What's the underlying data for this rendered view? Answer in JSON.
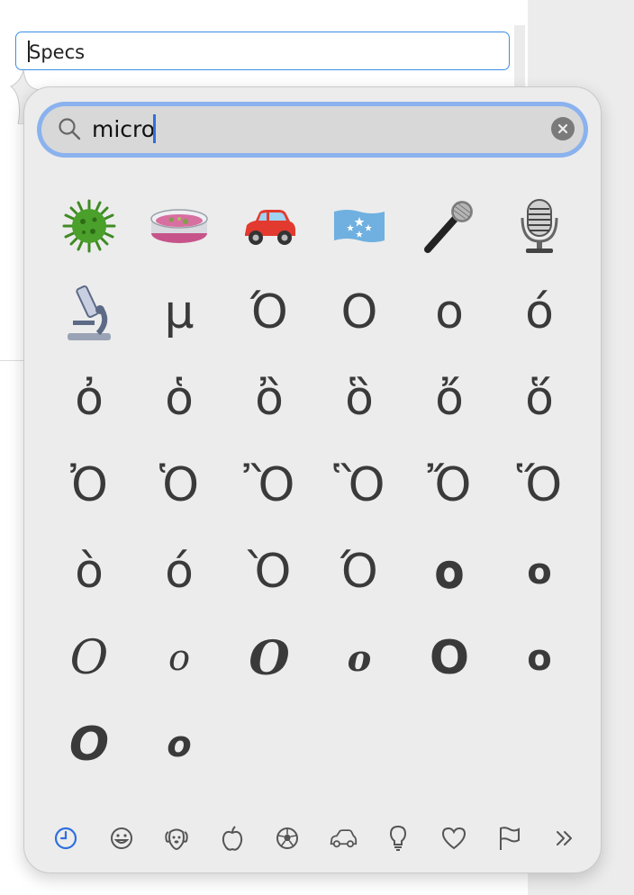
{
  "text_field": {
    "value": "Specs"
  },
  "search": {
    "query": "micro"
  },
  "results": [
    {
      "glyph": "",
      "icon": "microbe-emoji"
    },
    {
      "glyph": "",
      "icon": "petri-dish-emoji"
    },
    {
      "glyph": "",
      "icon": "automobile-emoji"
    },
    {
      "glyph": "",
      "icon": "flag-micronesia-emoji"
    },
    {
      "glyph": "",
      "icon": "microphone-emoji"
    },
    {
      "glyph": "",
      "icon": "studio-microphone-emoji"
    },
    {
      "glyph": "",
      "icon": "microscope-emoji"
    },
    {
      "glyph": "μ"
    },
    {
      "glyph": "Ό"
    },
    {
      "glyph": "Ο"
    },
    {
      "glyph": "ο"
    },
    {
      "glyph": "ό"
    },
    {
      "glyph": "ὀ"
    },
    {
      "glyph": "ὁ"
    },
    {
      "glyph": "ὂ"
    },
    {
      "glyph": "ὃ"
    },
    {
      "glyph": "ὄ"
    },
    {
      "glyph": "ὅ"
    },
    {
      "glyph": "Ὀ"
    },
    {
      "glyph": "Ὁ"
    },
    {
      "glyph": "Ὂ"
    },
    {
      "glyph": "Ὃ"
    },
    {
      "glyph": "Ὄ"
    },
    {
      "glyph": "Ὅ"
    },
    {
      "glyph": "ὸ"
    },
    {
      "glyph": "ό"
    },
    {
      "glyph": "Ὸ"
    },
    {
      "glyph": "Ό"
    },
    {
      "glyph": "𝛐"
    },
    {
      "glyph": "ο"
    },
    {
      "glyph": "𝑂"
    },
    {
      "glyph": "𝑜"
    },
    {
      "glyph": "𝑶"
    },
    {
      "glyph": "𝒐"
    },
    {
      "glyph": "𝗢"
    },
    {
      "glyph": "𝗼"
    },
    {
      "glyph": "𝙊"
    },
    {
      "glyph": "𝙤"
    }
  ],
  "category_tabs": [
    {
      "icon": "clock-icon",
      "selected": true
    },
    {
      "icon": "smiley-icon"
    },
    {
      "icon": "dog-icon"
    },
    {
      "icon": "apple-icon"
    },
    {
      "icon": "soccer-ball-icon"
    },
    {
      "icon": "car-icon"
    },
    {
      "icon": "lightbulb-icon"
    },
    {
      "icon": "heart-icon"
    },
    {
      "icon": "flag-icon"
    },
    {
      "icon": "more-chevron-icon"
    }
  ],
  "colors": {
    "accent": "#2f6fe0",
    "focus_ring": "#8ab2ee",
    "popover_bg": "#ececec",
    "glyph": "#3a3a3a"
  }
}
